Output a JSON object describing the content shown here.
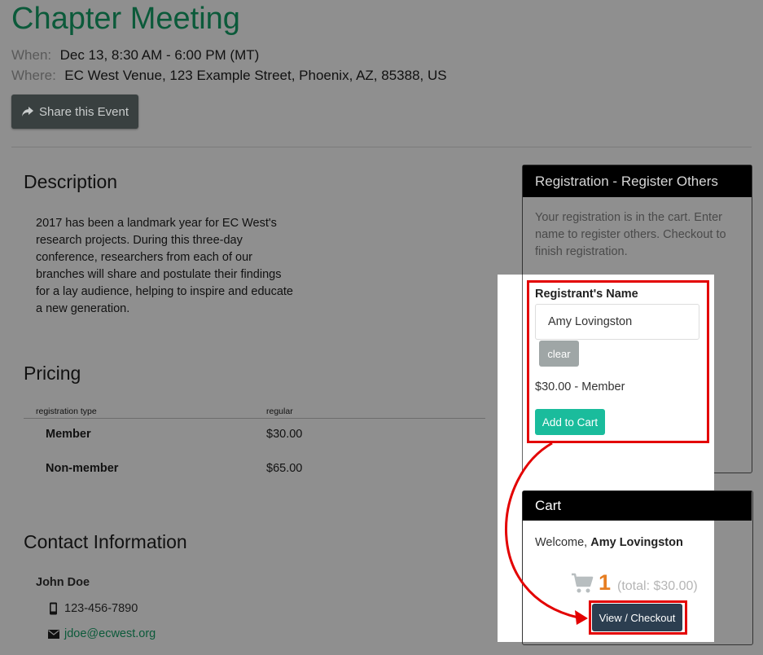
{
  "event": {
    "title": "Chapter Meeting",
    "when_label": "When:",
    "when_value": "Dec 13, 8:30 AM - 6:00 PM (MT)",
    "where_label": "Where:",
    "where_value": "EC West Venue, 123 Example Street, Phoenix, AZ, 85388, US",
    "share_label": "Share this Event"
  },
  "description": {
    "heading": "Description",
    "text": "2017 has been a landmark year for EC West's research projects. During this three-day conference, researchers from each of our branches will share and postulate their findings for a lay audience, helping to inspire and educate a new generation."
  },
  "pricing": {
    "heading": "Pricing",
    "columns": [
      "registration type",
      "regular"
    ],
    "rows": [
      {
        "type": "Member",
        "price": "$30.00"
      },
      {
        "type": "Non-member",
        "price": "$65.00"
      }
    ]
  },
  "contact": {
    "heading": "Contact Information",
    "name": "John Doe",
    "phone": "123-456-7890",
    "email": "jdoe@ecwest.org"
  },
  "registration": {
    "heading": "Registration - Register Others",
    "message": "Your registration is in the cart. Enter name to register others. Checkout to finish registration.",
    "name_label": "Registrant's Name",
    "name_value": "Amy Lovingston",
    "clear_label": "clear",
    "price_note": "$30.00 - Member",
    "add_label": "Add to Cart"
  },
  "cart": {
    "heading": "Cart",
    "welcome_prefix": "Welcome, ",
    "welcome_name": "Amy Lovingston",
    "count": "1",
    "total": "(total: $30.00)",
    "checkout_label": "View / Checkout"
  },
  "colors": {
    "title_green": "#0b5a3a",
    "highlight_red": "#e30000",
    "add_button": "#1abc9c",
    "checkout_button": "#2c3e50",
    "cart_count": "#e67e22"
  }
}
